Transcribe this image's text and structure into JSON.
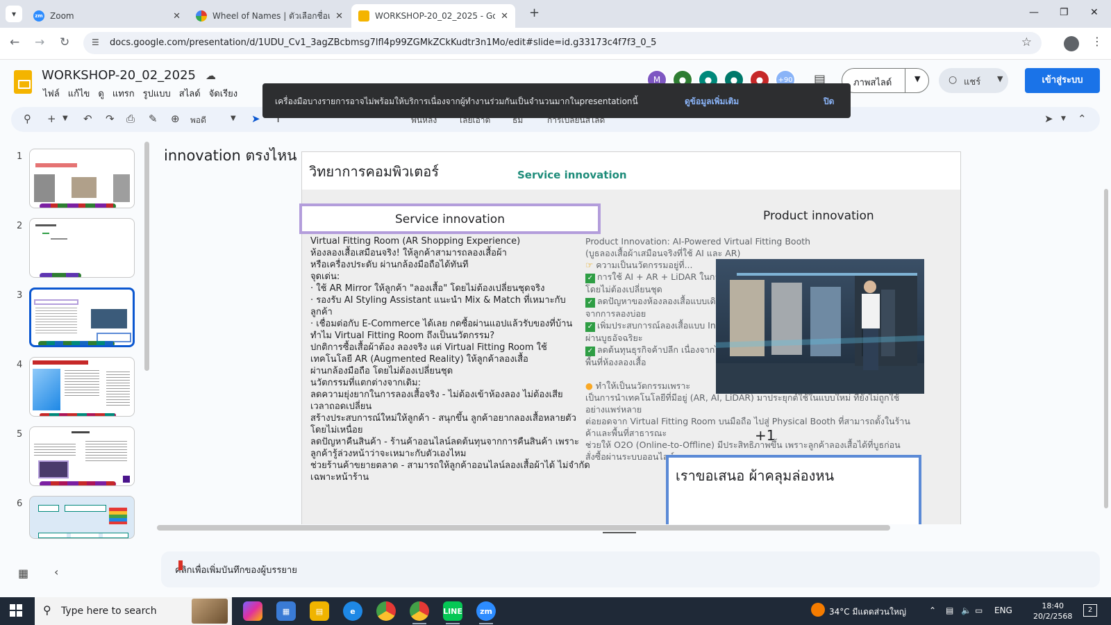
{
  "browser": {
    "tabs": [
      {
        "title": "Zoom",
        "favicon": "zoom-icon",
        "color": "#2d8cff",
        "active": false
      },
      {
        "title": "Wheel of Names | ตัวเลือกชื่อแบบ",
        "favicon": "wheel-icon",
        "color": "#e33b2e",
        "active": false
      },
      {
        "title": "WORKSHOP-20_02_2025 - Goo",
        "favicon": "slides-icon",
        "color": "#f4b400",
        "active": true
      }
    ],
    "url": "docs.google.com/presentation/d/1UDU_Cv1_3agZBcbmsg7lfl4p99ZGMkZCkKudtr3n1Mo/edit#slide=id.g33173c4f7f3_0_5"
  },
  "docs": {
    "title": "WORKSHOP-20_02_2025",
    "menu": [
      "ไฟล์",
      "แก้ไข",
      "ดู",
      "แทรก",
      "รูปแบบ",
      "สไลด์",
      "จัดเรียง"
    ],
    "avatar_more": "+90",
    "slideshow_label": "ภาพสไลด์",
    "share_label": "แชร์",
    "signin_label": "เข้าสู่ระบบ",
    "zoom_label": "พอดี",
    "toolbar_labels": [
      "พื้นหลัง",
      "เลย์เอาต์",
      "ธีม",
      "การเปลี่ยนสไลด์"
    ]
  },
  "toast": {
    "message": "เครื่องมือบางรายการอาจไม่พร้อมให้บริการเนื่องจากผู้ทำงานร่วมกันเป็นจำนวนมากในpresentationนี้",
    "more": "ดูข้อมูลเพิ่มเติม",
    "close": "ปิด"
  },
  "filmstrip": {
    "numbers": [
      "1",
      "2",
      "3",
      "4",
      "5",
      "6"
    ],
    "active_index": 2
  },
  "slide": {
    "outside_title": "innovation ตรงไหน",
    "heading": "วิทยาการคอมพิวเตอร์",
    "subheading": "Service innovation",
    "service_box": "Service innovation",
    "product_heading": "Product innovation",
    "left_lines": [
      "Virtual Fitting Room (AR Shopping Experience)",
      "ห้องลองเสื้อเสมือนจริง! ให้ลูกค้าสามารถลองเสื้อผ้า",
      "หรือเครื่องประดับ ผ่านกล้องมือถือได้ทันที",
      "จุดเด่น:",
      "· ใช้ AR Mirror ให้ลูกค้า \"ลองเสื้อ\" โดยไม่ต้องเปลี่ยนชุดจริง",
      "· รองรับ AI Styling Assistant แนะนำ Mix & Match ที่เหมาะกับ",
      "ลูกค้า",
      "· เชื่อมต่อกับ E-Commerce ได้เลย กดซื้อผ่านแอปแล้วรับของที่บ้าน",
      "ทำไม Virtual Fitting Room ถึงเป็นนวัตกรรม?",
      "ปกติการซื้อเสื้อผ้าต้อง ลองจริง แต่ Virtual Fitting Room ใช้",
      "เทคโนโลยี AR (Augmented Reality) ให้ลูกค้าลองเสื้อ",
      "ผ่านกล้องมือถือ โดยไม่ต้องเปลี่ยนชุด",
      "นวัตกรรมที่แตกต่างจากเดิม:",
      "ลดความยุ่งยากในการลองเสื้อจริง - ไม่ต้องเข้าห้องลอง ไม่ต้องเสีย",
      "เวลาถอดเปลี่ยน",
      "สร้างประสบการณ์ใหม่ให้ลูกค้า - สนุกขึ้น ลูกค้าอยากลองเสื้อหลายตัว",
      "โดยไม่เหนื่อย",
      "ลดปัญหาคืนสินค้า - ร้านค้าออนไลน์ลดต้นทุนจากการคืนสินค้า เพราะ",
      "ลูกค้ารู้ล่วงหน้าว่าจะเหมาะกับตัวเองไหม",
      "ช่วยร้านค้าขยายตลาด - สามารถให้ลูกค้าออนไลน์ลองเสื้อผ้าได้ ไม่จำกัด",
      "เฉพาะหน้าร้าน"
    ],
    "right_lines": [
      {
        "text": "Product Innovation: AI-Powered Virtual Fitting Booth",
        "mark": ""
      },
      {
        "text": "(บูธลองเสื้อผ้าเสมือนจริงที่ใช้ AI และ AR)",
        "mark": ""
      },
      {
        "text": "ความเป็นนวัตกรรมอยู่ที่...",
        "mark": "point"
      },
      {
        "text": "การใช้ AI + AR + LiDAR ในการวัดร่างกายและแนะนำไซส์ ลูกค้าลองการสวมเสื้อ",
        "mark": "check"
      },
      {
        "text": "โดยไม่ต้องเปลี่ยนชุด",
        "mark": ""
      },
      {
        "text": "ลดปัญหาของห้องลองเสื้อแบบเดิม เช่น การเปลี่ยนเสื้อหลายรอบ, เสียเวลาลอง",
        "mark": "check"
      },
      {
        "text": "จากการลองบ่อย",
        "mark": ""
      },
      {
        "text": "เพิ่มประสบการณ์ลองเสื้อแบบ Interactive โดยที่ลูกค้าสามารถลองสีหรือชุดได้ทันที",
        "mark": "check"
      },
      {
        "text": "ผ่านบูธอัจฉริยะ",
        "mark": ""
      },
      {
        "text": "ลดต้นทุนธุรกิจค้าปลีก เนื่องจากไม่ต้องจัดพื้นที่ห้องลองมาก และลด",
        "mark": "check"
      },
      {
        "text": "พื้นที่ห้องลองเสื้อ",
        "mark": ""
      },
      {
        "text": "",
        "mark": ""
      },
      {
        "text": "ทำให้เป็นนวัตกรรมเพราะ",
        "mark": "bulb"
      },
      {
        "text": "เป็นการนำเทคโนโลยีที่มีอยู่ (AR, AI, LiDAR) มาประยุกต์ใช้ในแบบใหม่ ที่ยังไม่ถูกใช้",
        "mark": ""
      },
      {
        "text": "อย่างแพร่หลาย",
        "mark": ""
      },
      {
        "text": "ต่อยอดจาก Virtual Fitting Room บนมือถือ ไปสู่ Physical Booth ที่สามารถตั้งในร้าน",
        "mark": ""
      },
      {
        "text": "ค้าและพื้นที่สาธารณะ",
        "mark": ""
      },
      {
        "text": "ช่วยให้ O2O (Online-to-Offline) มีประสิทธิภาพขึ้น เพราะลูกค้าลองเสื้อได้ที่บูธก่อน",
        "mark": ""
      },
      {
        "text": "สั่งซื้อผ่านระบบออนไลน์",
        "mark": ""
      }
    ],
    "plus_one": "+1",
    "offer_box": "เราขอเสนอ ผ้าคลุมล่องหน"
  },
  "notes": {
    "placeholder": "คลิกเพื่อเพิ่มบันทึกของผู้บรรยาย"
  },
  "taskbar": {
    "search_placeholder": "Type here to search",
    "weather": "34°C  มีแดดส่วนใหญ่",
    "lang": "ENG",
    "time": "18:40",
    "date": "20/2/2568",
    "notif_count": "2"
  }
}
